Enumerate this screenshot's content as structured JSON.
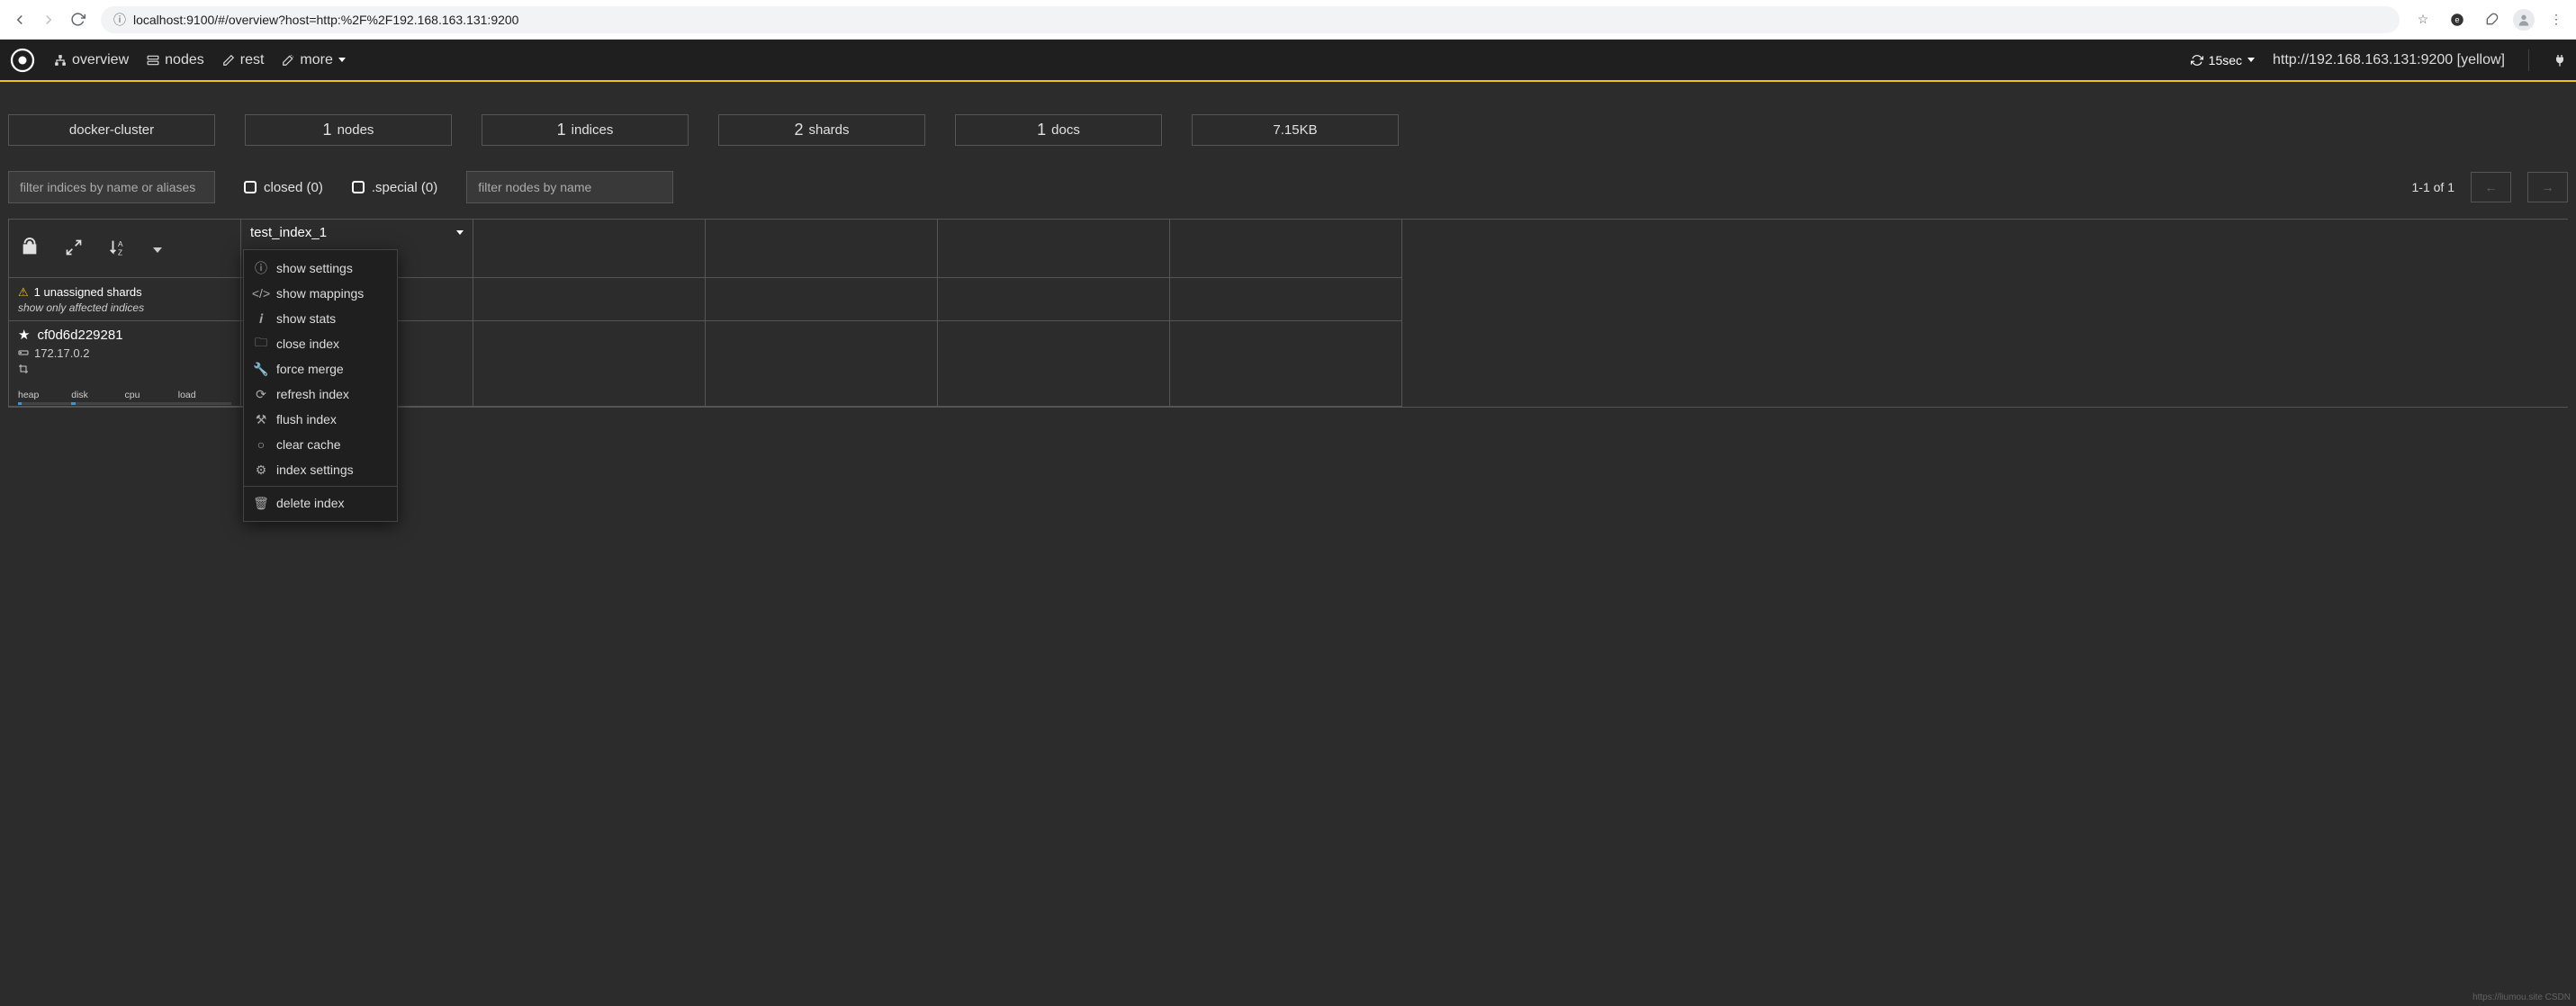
{
  "browser": {
    "url": "localhost:9100/#/overview?host=http:%2F%2F192.168.163.131:9200"
  },
  "header": {
    "nav": {
      "overview": "overview",
      "nodes": "nodes",
      "rest": "rest",
      "more": "more"
    },
    "refresh": "15sec",
    "host": "http://192.168.163.131:9200 [yellow]"
  },
  "stats": {
    "cluster": "docker-cluster",
    "nodes_n": "1",
    "nodes_lbl": "nodes",
    "indices_n": "1",
    "indices_lbl": "indices",
    "shards_n": "2",
    "shards_lbl": "shards",
    "docs_n": "1",
    "docs_lbl": "docs",
    "size": "7.15KB"
  },
  "filters": {
    "idx_ph": "filter indices by name or aliases",
    "closed": "closed (0)",
    "special": ".special (0)",
    "node_ph": "filter nodes by name",
    "page": "1-1 of 1"
  },
  "index": {
    "name": "test_index_1"
  },
  "warn": {
    "line1": "1 unassigned shards",
    "line2": "show only affected indices"
  },
  "node": {
    "name": "cf0d6d229281",
    "ip": "172.17.0.2",
    "stats": {
      "heap": "heap",
      "disk": "disk",
      "cpu": "cpu",
      "load": "load"
    },
    "bars": {
      "heap": 6,
      "disk": 8,
      "cpu": 0,
      "load": 0
    }
  },
  "menu": {
    "show_settings": "show settings",
    "show_mappings": "show mappings",
    "show_stats": "show stats",
    "close_index": "close index",
    "force_merge": "force merge",
    "refresh_index": "refresh index",
    "flush_index": "flush index",
    "clear_cache": "clear cache",
    "index_settings": "index settings",
    "delete_index": "delete index"
  },
  "watermark": "https://liumou.site CSDN"
}
